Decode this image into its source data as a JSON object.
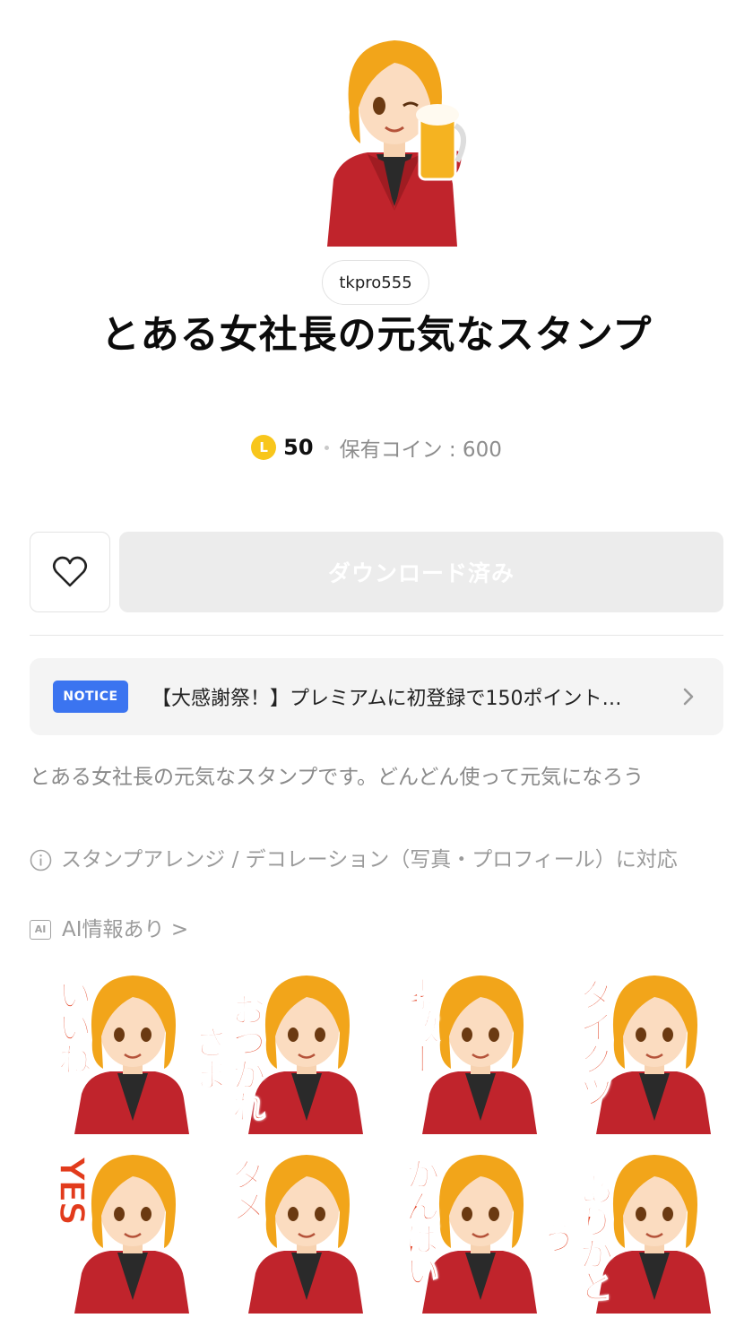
{
  "sticker_set": {
    "author": "tkpro555",
    "title": "とある女社長の元気なスタンプ",
    "price": "50",
    "coin_symbol": "L",
    "owned_coins": "保有コイン : 600"
  },
  "actions": {
    "favorite_icon": "heart-outline-icon",
    "download_label": "ダウンロード済み"
  },
  "notice": {
    "badge": "NOTICE",
    "text": "【大感謝祭！】プレミアムに初登録で150ポイント…"
  },
  "description": "とある女社長の元気なスタンプです。どんどん使って元気になろう",
  "meta": {
    "arrange_text": "スタンプアレンジ / デコレーション（写真・プロフィール）に対応",
    "ai_badge": "AI",
    "ai_text": "AI情報あり >"
  },
  "stickers": [
    {
      "caption": "いいね"
    },
    {
      "caption": "おつかれさま"
    },
    {
      "caption": "素敵ー"
    },
    {
      "caption": "タイクツ"
    },
    {
      "caption": "YES"
    },
    {
      "caption": "ダメ"
    },
    {
      "caption": "かんぱい"
    },
    {
      "caption": "ありがとう"
    }
  ],
  "colors": {
    "accent_blue": "#3b74f0",
    "coin": "#f8c61c",
    "sticker_text": "#e23b1c",
    "hair": "#f2a51a",
    "jacket": "#c0242c"
  }
}
